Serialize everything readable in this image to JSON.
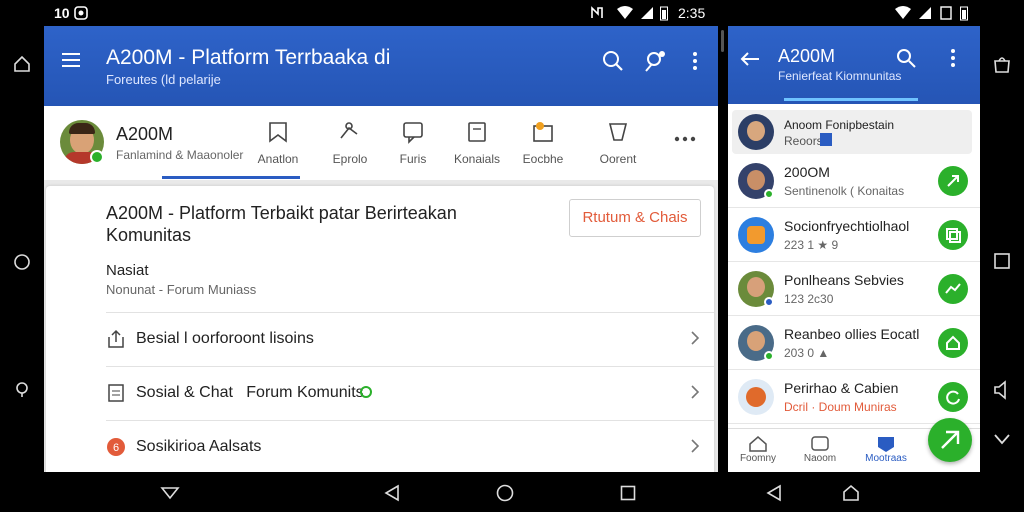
{
  "main": {
    "status": {
      "time": "10",
      "clock": "2:35"
    },
    "appbar": {
      "title": "A200M - Platform Terrbaaka di",
      "subtitle": "Foreutes (ld pelarije"
    },
    "profile": {
      "name": "A200M",
      "subtitle": "Fanlamind & Maaonoler"
    },
    "tabs": [
      {
        "label": "Anatlon"
      },
      {
        "label": "Eprolo"
      },
      {
        "label": "Furis"
      },
      {
        "label": "Konaials"
      },
      {
        "label": "Eocbhe"
      },
      {
        "label": "Oorent"
      }
    ],
    "card": {
      "headline": "A200M - Platform Terbaikt patar Berirteakan Komunitas",
      "cta_button": "Rtutum & Chais",
      "section_title": "Nasiat",
      "section_sub": "Nonunat - Forum Muniass"
    },
    "rows": [
      {
        "label": "Besial l oorforoont lisoins"
      },
      {
        "label": "Sosial & Chat   Forum Komunits"
      },
      {
        "label": "Sosikirioa Aalsats"
      }
    ]
  },
  "second": {
    "status": {
      "clock": ""
    },
    "appbar": {
      "title": "A200M",
      "subtitle": "Fenierfeat Kiomnunitas"
    },
    "pinned": {
      "name": "Anoom Fonipbestain",
      "meta": "Reoors"
    },
    "contacts": [
      {
        "name": "200OM",
        "meta": "Sentinenolk ( Konaitas"
      },
      {
        "name": "Socionfryechtiolhaol",
        "meta": "223 1 ★ 9"
      },
      {
        "name": "Ponlheans Sebvies",
        "meta": "123 2c30"
      },
      {
        "name": "Reanbeo ollies Eocatl",
        "meta": "203 0 ▲"
      },
      {
        "name": "Perirhao & Cabien",
        "meta": "Dcril · Doum Muniras"
      }
    ],
    "bottom_tabs": [
      {
        "label": "Foomny"
      },
      {
        "label": "Naoom"
      },
      {
        "label": "Mootraas"
      }
    ]
  },
  "colors": {
    "primary": "#2a5cc2",
    "accent_green": "#2bb02b",
    "cta_red": "#e25b3a"
  }
}
